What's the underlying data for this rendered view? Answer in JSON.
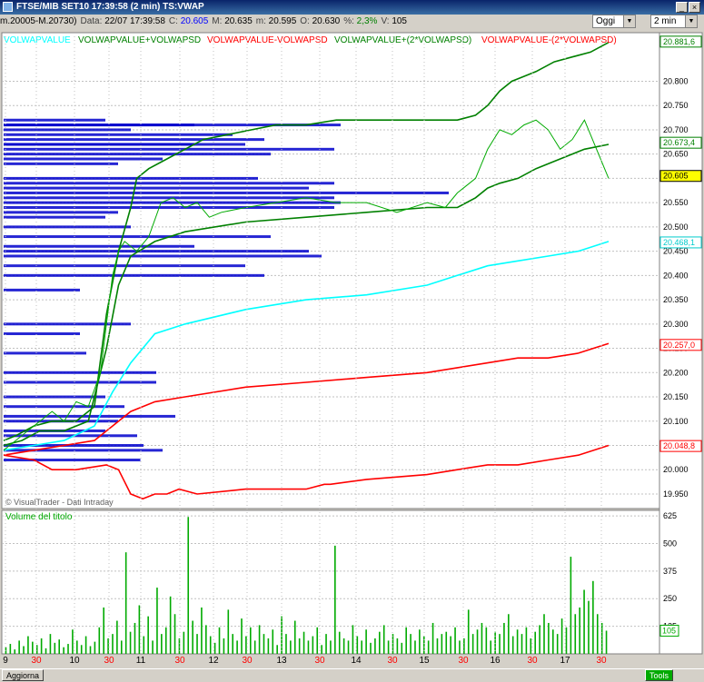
{
  "window": {
    "title": "FTSE/MIB SET10  17:39:58  (2 min) TS:VWAP"
  },
  "toolbar": {
    "period": "Oggi",
    "interval": "2 min"
  },
  "info": [
    {
      "label": "",
      "value": "m.20005-M.20730)"
    },
    {
      "label": "Data:",
      "value": "22/07 17:39:58"
    },
    {
      "label": "C:",
      "value": "20.605",
      "cls": "blue"
    },
    {
      "label": "M:",
      "value": "20.635"
    },
    {
      "label": "m:",
      "value": "20.595"
    },
    {
      "label": "O:",
      "value": "20.630"
    },
    {
      "label": "%:",
      "value": "2,3%",
      "cls": "green"
    },
    {
      "label": "V:",
      "value": "105"
    }
  ],
  "legend": [
    {
      "label": "VOLWAPVALUE",
      "color": "#00ffff"
    },
    {
      "label": "VOLWAPVALUE+VOLWAPSD",
      "color": "#008000"
    },
    {
      "label": "VOLWAPVALUE-VOLWAPSD",
      "color": "#ff0000"
    },
    {
      "label": "VOLWAPVALUE+(2*VOLWAPSD)",
      "color": "#008000"
    },
    {
      "label": "VOLWAPVALUE-(2*VOLWAPSD)",
      "color": "#ff0000"
    }
  ],
  "price_axis": [
    "20.800",
    "20.750",
    "20.700",
    "20.650",
    "20.600",
    "20.550",
    "20.500",
    "20.450",
    "20.400",
    "20.350",
    "20.300",
    "20.250",
    "20.200",
    "20.150",
    "20.100",
    "20.050",
    "20.000",
    "19.950"
  ],
  "price_tags": [
    {
      "text": "20.881,6",
      "value": 20.8816,
      "color": "#008000",
      "bg": "#ffffff"
    },
    {
      "text": "20.673,4",
      "value": 20.6734,
      "color": "#008000",
      "bg": "#ffffff"
    },
    {
      "text": "20.605",
      "value": 20.605,
      "color": "#000000",
      "bg": "#ffff00"
    },
    {
      "text": "20.468,1",
      "value": 20.4681,
      "color": "#00cccc",
      "bg": "#ffffff"
    },
    {
      "text": "20.257,0",
      "value": 20.257,
      "color": "#ff0000",
      "bg": "#ffffff"
    },
    {
      "text": "20.048,8",
      "value": 20.0488,
      "color": "#ff0000",
      "bg": "#ffffff"
    }
  ],
  "watermark": "© VisualTrader - Dati Intraday",
  "volume_title": "Volume del titolo",
  "volume_axis": [
    "625",
    "500",
    "375",
    "250",
    "125"
  ],
  "volume_last": "105",
  "time_labels": [
    "9",
    "30",
    "10",
    "30",
    "11",
    "30",
    "12",
    "30",
    "13",
    "30",
    "14",
    "30",
    "15",
    "30",
    "16",
    "30",
    "17",
    "30"
  ],
  "bottom": {
    "update": "Aggiorna",
    "tools": "Tools"
  },
  "colors": {
    "grid": "#c0c0c0",
    "chart_bg": "#ffffff",
    "price": "#00aa00",
    "profile": "#0000cc"
  },
  "chart_data": {
    "type": "line",
    "title": "FTSE/MIB SET10  17:39:58  (2 min) TS:VWAP",
    "ylim": [
      19.92,
      20.9
    ],
    "series": [
      {
        "name": "VOLWAPVALUE+(2*VOLWAPSD)",
        "color": "#008000",
        "x": [
          0,
          0.02,
          0.05,
          0.08,
          0.12,
          0.15,
          0.17,
          0.19,
          0.21,
          0.22,
          0.24,
          0.27,
          0.3,
          0.33,
          0.37,
          0.41,
          0.45,
          0.5,
          0.55,
          0.6,
          0.65,
          0.7,
          0.75,
          0.78,
          0.8,
          0.82,
          0.84,
          0.86,
          0.88,
          0.91,
          0.94,
          0.97,
          1.0
        ],
        "y": [
          20.06,
          20.07,
          20.09,
          20.1,
          20.1,
          20.13,
          20.32,
          20.45,
          20.54,
          20.6,
          20.62,
          20.64,
          20.66,
          20.68,
          20.69,
          20.7,
          20.71,
          20.71,
          20.72,
          20.72,
          20.72,
          20.72,
          20.72,
          20.73,
          20.75,
          20.78,
          20.8,
          20.81,
          20.82,
          20.84,
          20.85,
          20.86,
          20.88
        ]
      },
      {
        "name": "VOLWAPVALUE+VOLWAPSD",
        "color": "#008000",
        "x": [
          0,
          0.03,
          0.06,
          0.1,
          0.14,
          0.17,
          0.19,
          0.21,
          0.25,
          0.3,
          0.4,
          0.5,
          0.6,
          0.7,
          0.75,
          0.78,
          0.8,
          0.82,
          0.85,
          0.88,
          0.92,
          0.96,
          1.0
        ],
        "y": [
          20.05,
          20.06,
          20.08,
          20.08,
          20.1,
          20.25,
          20.38,
          20.44,
          20.47,
          20.49,
          20.51,
          20.52,
          20.53,
          20.54,
          20.54,
          20.56,
          20.58,
          20.59,
          20.6,
          20.62,
          20.64,
          20.66,
          20.67
        ]
      },
      {
        "name": "VOLWAPVALUE",
        "color": "#00ffff",
        "x": [
          0,
          0.05,
          0.1,
          0.15,
          0.18,
          0.21,
          0.25,
          0.3,
          0.4,
          0.5,
          0.6,
          0.7,
          0.75,
          0.8,
          0.85,
          0.9,
          0.95,
          1.0
        ],
        "y": [
          20.04,
          20.05,
          20.06,
          20.09,
          20.16,
          20.22,
          20.28,
          20.3,
          20.33,
          20.35,
          20.36,
          20.38,
          20.4,
          20.42,
          20.43,
          20.44,
          20.45,
          20.47
        ]
      },
      {
        "name": "VOLWAPVALUE-VOLWAPSD",
        "color": "#ff0000",
        "x": [
          0,
          0.05,
          0.1,
          0.15,
          0.18,
          0.21,
          0.25,
          0.3,
          0.4,
          0.5,
          0.6,
          0.7,
          0.75,
          0.8,
          0.85,
          0.9,
          0.95,
          1.0
        ],
        "y": [
          20.03,
          20.04,
          20.05,
          20.06,
          20.09,
          20.12,
          20.14,
          20.15,
          20.17,
          20.18,
          20.19,
          20.2,
          20.21,
          20.22,
          20.23,
          20.23,
          20.24,
          20.26
        ]
      },
      {
        "name": "VOLWAPVALUE-(2*VOLWAPSD)",
        "color": "#ff0000",
        "x": [
          0,
          0.05,
          0.08,
          0.12,
          0.17,
          0.19,
          0.21,
          0.23,
          0.25,
          0.27,
          0.29,
          0.32,
          0.4,
          0.5,
          0.53,
          0.54,
          0.6,
          0.7,
          0.75,
          0.8,
          0.85,
          0.9,
          0.95,
          1.0
        ],
        "y": [
          20.03,
          20.02,
          20.0,
          20.0,
          20.01,
          20.0,
          19.95,
          19.94,
          19.95,
          19.95,
          19.96,
          19.95,
          19.96,
          19.96,
          19.97,
          19.97,
          19.98,
          19.99,
          20.0,
          20.01,
          20.01,
          20.02,
          20.03,
          20.05
        ]
      },
      {
        "name": "Price",
        "color": "#00aa00",
        "x": [
          0,
          0.02,
          0.04,
          0.06,
          0.08,
          0.1,
          0.12,
          0.14,
          0.16,
          0.17,
          0.18,
          0.19,
          0.2,
          0.22,
          0.24,
          0.26,
          0.28,
          0.3,
          0.32,
          0.34,
          0.36,
          0.4,
          0.45,
          0.5,
          0.55,
          0.6,
          0.65,
          0.7,
          0.73,
          0.75,
          0.78,
          0.8,
          0.82,
          0.84,
          0.86,
          0.88,
          0.9,
          0.92,
          0.94,
          0.96,
          0.98,
          1.0
        ],
        "y": [
          20.04,
          20.06,
          20.08,
          20.1,
          20.12,
          20.1,
          20.14,
          20.13,
          20.2,
          20.3,
          20.4,
          20.45,
          20.47,
          20.45,
          20.48,
          20.55,
          20.56,
          20.54,
          20.55,
          20.52,
          20.53,
          20.54,
          20.55,
          20.56,
          20.55,
          20.55,
          20.53,
          20.55,
          20.54,
          20.57,
          20.6,
          20.66,
          20.7,
          20.69,
          20.71,
          20.72,
          20.7,
          20.66,
          20.68,
          20.72,
          20.66,
          20.6
        ]
      }
    ],
    "volume_ylim": [
      0,
      650
    ],
    "volume": [
      30,
      45,
      20,
      60,
      35,
      80,
      55,
      40,
      70,
      25,
      90,
      50,
      65,
      30,
      45,
      110,
      60,
      40,
      80,
      35,
      55,
      120,
      210,
      70,
      90,
      150,
      60,
      460,
      100,
      140,
      220,
      80,
      170,
      60,
      300,
      90,
      120,
      260,
      180,
      70,
      100,
      620,
      150,
      90,
      210,
      130,
      80,
      50,
      120,
      70,
      200,
      90,
      60,
      160,
      80,
      120,
      60,
      130,
      90,
      70,
      110,
      40,
      170,
      90,
      60,
      150,
      70,
      100,
      60,
      80,
      120,
      40,
      90,
      60,
      490,
      100,
      70,
      60,
      130,
      80,
      60,
      110,
      50,
      70,
      100,
      130,
      60,
      90,
      70,
      50,
      120,
      90,
      60,
      110,
      80,
      60,
      140,
      70,
      90,
      100,
      80,
      120,
      60,
      70,
      200,
      90,
      110,
      140,
      120,
      60,
      100,
      90,
      140,
      180,
      80,
      110,
      90,
      120,
      70,
      100,
      130,
      180,
      140,
      110,
      90,
      160,
      120,
      440,
      180,
      210,
      290,
      240,
      330,
      180,
      140,
      105
    ]
  }
}
